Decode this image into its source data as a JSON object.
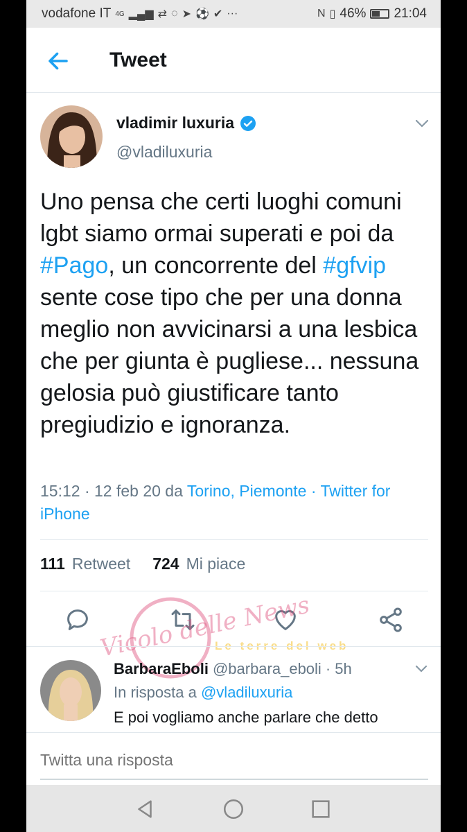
{
  "status_bar": {
    "carrier": "vodafone IT",
    "network": "4G",
    "battery": "46%",
    "battery_level": 0.46,
    "time": "21:04"
  },
  "header": {
    "back_icon": "arrow-left-icon",
    "title": "Tweet"
  },
  "tweet": {
    "author_name": "vladimir luxuria",
    "author_handle": "@vladiluxuria",
    "text_segments": [
      "Uno pensa che certi luoghi comuni lgbt siamo ormai superati e poi da ",
      "#Pago",
      ", un concorrente del ",
      "#gfvip",
      " sente cose tipo che per una donna meglio non avvicinarsi a una lesbica che per giunta è pugliese... nessuna gelosia può giustificare tanto pregiudizio e ignoranza."
    ],
    "timestamp": "15:12 · 12 feb 20 da ",
    "location": "Torino, Piemonte",
    "separator": " · ",
    "source_part1": "Twitter for",
    "source_part2": "iPhone",
    "retweet_count": "111",
    "retweet_label": "Retweet",
    "like_count": "724",
    "like_label": "Mi piace"
  },
  "reply": {
    "name": "BarbaraEboli",
    "handle": "@barbara_eboli",
    "time": "· 5h",
    "in_reply_label": "In risposta a",
    "in_reply_handle": "@vladiluxuria",
    "text": "E poi vogliamo anche parlare che detto"
  },
  "compose": {
    "placeholder": "Twitta una risposta"
  },
  "watermark": {
    "left_text": "Vicolo delle News",
    "right_text": "Le terre del web"
  },
  "colors": {
    "accent": "#1da1f2",
    "text": "#14171a",
    "muted": "#657786"
  }
}
